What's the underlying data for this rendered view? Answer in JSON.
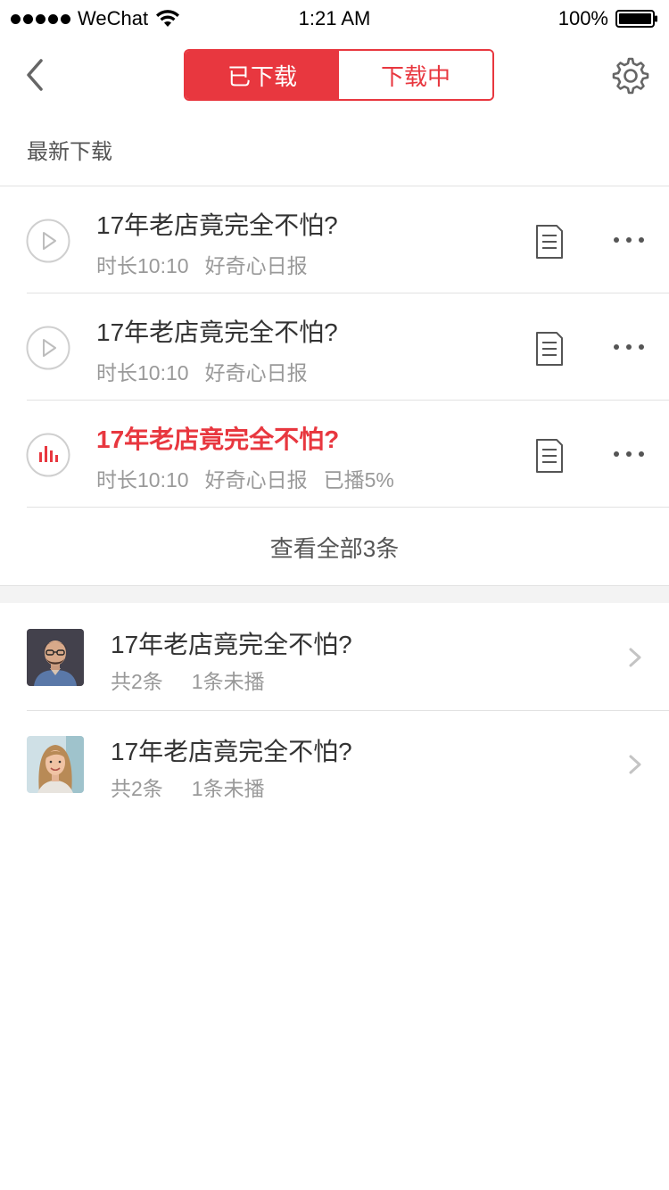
{
  "status_bar": {
    "carrier": "WeChat",
    "time": "1:21 AM",
    "battery": "100%"
  },
  "nav": {
    "tabs": [
      {
        "label": "已下载",
        "active": true
      },
      {
        "label": "下载中",
        "active": false
      }
    ]
  },
  "section_title": "最新下载",
  "downloads": [
    {
      "title": "17年老店竟完全不怕?",
      "duration": "时长10:10",
      "source": "好奇心日报",
      "progress": "",
      "state": "idle",
      "icon": "play-icon"
    },
    {
      "title": "17年老店竟完全不怕?",
      "duration": "时长10:10",
      "source": "好奇心日报",
      "progress": "",
      "state": "idle",
      "icon": "play-icon"
    },
    {
      "title": "17年老店竟完全不怕?",
      "duration": "时长10:10",
      "source": "好奇心日报",
      "progress": "已播5%",
      "state": "playing",
      "icon": "equalizer-icon"
    }
  ],
  "view_all": "查看全部3条",
  "albums": [
    {
      "title": "17年老店竟完全不怕?",
      "count": "共2条",
      "unplayed": "1条未播"
    },
    {
      "title": "17年老店竟完全不怕?",
      "count": "共2条",
      "unplayed": "1条未播"
    }
  ],
  "colors": {
    "accent": "#e8373f",
    "text_primary": "#333333",
    "text_secondary": "#999999",
    "divider": "#e2e2e2"
  }
}
